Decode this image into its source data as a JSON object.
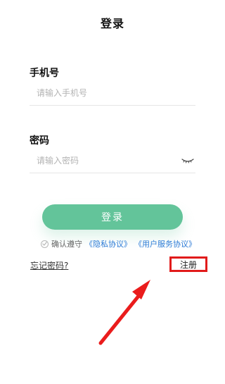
{
  "header": {
    "title": "登录"
  },
  "form": {
    "phone_label": "手机号",
    "phone_placeholder": "请输入手机号",
    "password_label": "密码",
    "password_placeholder": "请输入密码",
    "login_button": "登录",
    "agreement_prefix": "确认遵守",
    "privacy_link": "《隐私协议》",
    "service_link": "《用户服务协议》"
  },
  "footer": {
    "forgot_password": "忘记密码?",
    "register": "注册"
  },
  "colors": {
    "primary_green": "#63c49a",
    "link_blue": "#2d7bd6",
    "highlight_red": "#e11b1b"
  },
  "icons": {
    "password_toggle": "eye-closed-icon",
    "agreement_checkbox": "radio-circle-icon",
    "annotation": "red-arrow-annotation"
  }
}
